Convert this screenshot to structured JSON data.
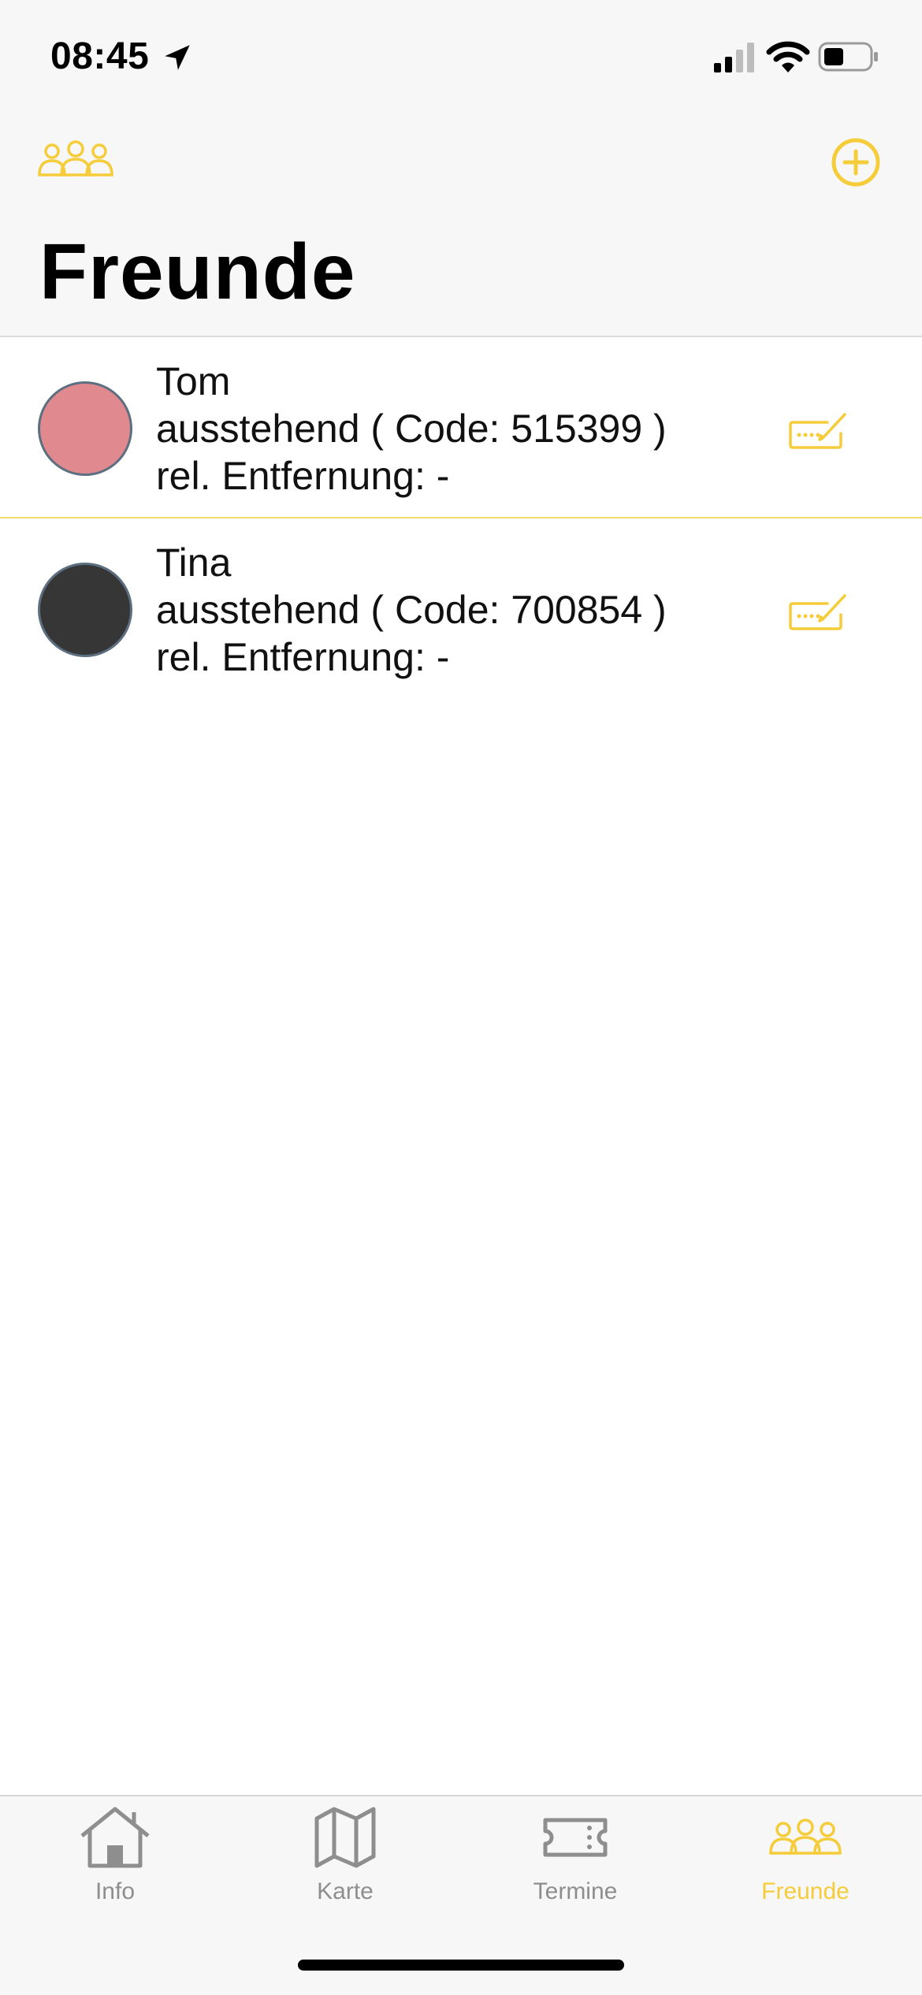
{
  "status_bar": {
    "time": "08:45"
  },
  "header": {
    "title": "Freunde"
  },
  "friends": [
    {
      "name": "Tom",
      "status": "ausstehend ( Code: 515399 )",
      "distance": "rel. Entfernung: -",
      "color": "#e08a8f"
    },
    {
      "name": "Tina",
      "status": "ausstehend ( Code: 700854 )",
      "distance": "rel. Entfernung: -",
      "color": "#363636"
    }
  ],
  "tabs": [
    {
      "label": "Info",
      "icon": "house-icon"
    },
    {
      "label": "Karte",
      "icon": "map-icon"
    },
    {
      "label": "Termine",
      "icon": "ticket-icon"
    },
    {
      "label": "Freunde",
      "icon": "people-icon",
      "active": true
    }
  ],
  "colors": {
    "accent": "#f5cc3a",
    "inactive": "#8e8e8e"
  }
}
